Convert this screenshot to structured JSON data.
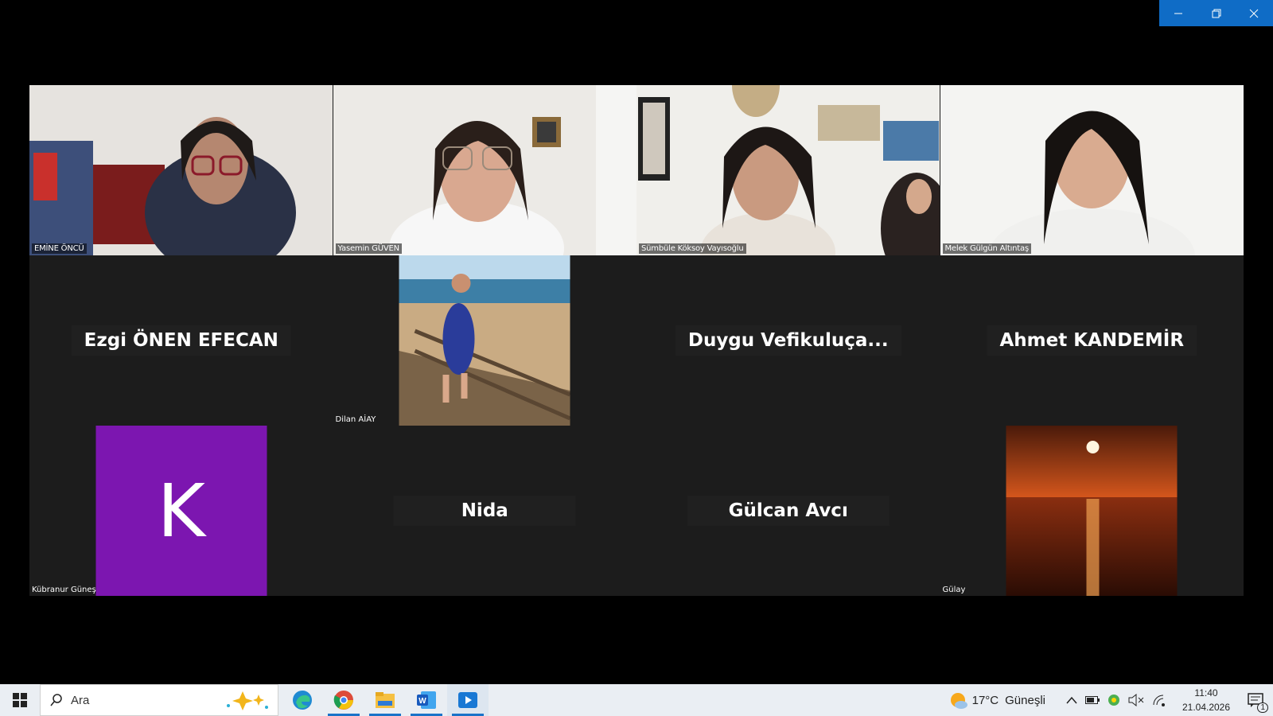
{
  "window": {
    "controls": [
      "minimize-icon",
      "restore-icon",
      "close-icon"
    ],
    "accent": "#0f6cc6"
  },
  "participants": [
    {
      "name": "EMİNE ÖNCÜ",
      "type": "video"
    },
    {
      "name": "Yasemin GÜVEN",
      "type": "video"
    },
    {
      "name": "Sümbüle Köksoy Vayısoğlu",
      "type": "video"
    },
    {
      "name": "Melek Gülgün Altıntaş",
      "type": "video"
    },
    {
      "name": "Ezgi ÖNEN EFECAN",
      "type": "name"
    },
    {
      "name": "Dilan AİAY",
      "type": "photo"
    },
    {
      "name": "Duygu  Vefikuluça...",
      "type": "name"
    },
    {
      "name": "Ahmet KANDEMİR",
      "type": "name"
    },
    {
      "name": "Kübranur Güneş",
      "type": "initial",
      "initial": "K",
      "color": "#7c16b0"
    },
    {
      "name": "Nida",
      "type": "name"
    },
    {
      "name": "Gülcan Avcı",
      "type": "name"
    },
    {
      "name": "Gülay",
      "type": "photo"
    }
  ],
  "taskbar": {
    "search_placeholder": "Ara",
    "apps": [
      "edge-icon",
      "chrome-icon",
      "file-explorer-icon",
      "word-icon",
      "media-player-icon"
    ],
    "weather": {
      "temp": "17°C",
      "condition": "Güneşli"
    },
    "clock": {
      "time": "11:40",
      "date": "21.04.2026"
    },
    "notification_count": "1"
  }
}
